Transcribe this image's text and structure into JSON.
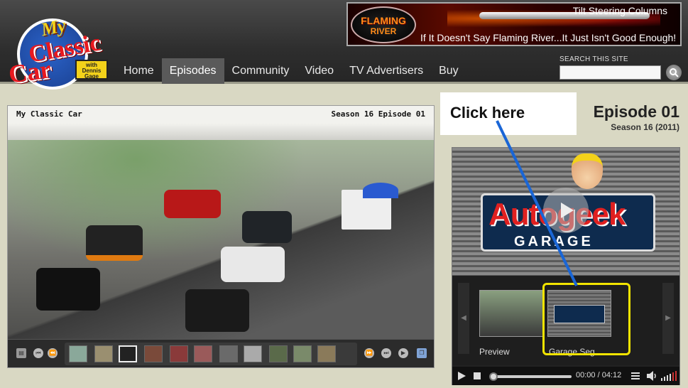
{
  "logo": {
    "line1": "My",
    "line2": "Classic",
    "line3": "Car",
    "badge": "with Dennis Gage"
  },
  "ad": {
    "brand_line1": "FLAMING",
    "brand_line2": "RIVER",
    "title": "Tilt Steering Columns",
    "slogan": "If It Doesn't Say Flaming River...It Just Isn't Good Enough!"
  },
  "nav": {
    "items": [
      "Home",
      "Episodes",
      "Community",
      "Video",
      "TV Advertisers",
      "Buy"
    ],
    "active": "Episodes"
  },
  "search": {
    "label": "SEARCH THIS SITE",
    "value": ""
  },
  "player": {
    "title_left": "My Classic Car",
    "title_right": "Season 16 Episode 01"
  },
  "annotation": {
    "text": "Click here",
    "color": "#1a66d6",
    "highlight_color": "#f2e400"
  },
  "episode": {
    "title": "Episode 01",
    "subtitle": "Season 16 (2011)"
  },
  "side_video": {
    "sign_word1": "Autogeek",
    "sign_word2": "GARAGE",
    "thumbs": [
      {
        "label": "Preview"
      },
      {
        "label": "Garage Seg"
      }
    ],
    "time": "00:00 / 04:12",
    "progress": 0
  },
  "icons": {
    "search": "magnifier-icon",
    "play": "play-icon",
    "stop": "stop-icon",
    "volume": "volume-icon",
    "playlist": "playlist-icon",
    "prev": "prev-icon",
    "next": "next-icon",
    "rewind": "rewind-icon",
    "forward": "forward-icon",
    "fullscreen": "fullscreen-icon"
  }
}
